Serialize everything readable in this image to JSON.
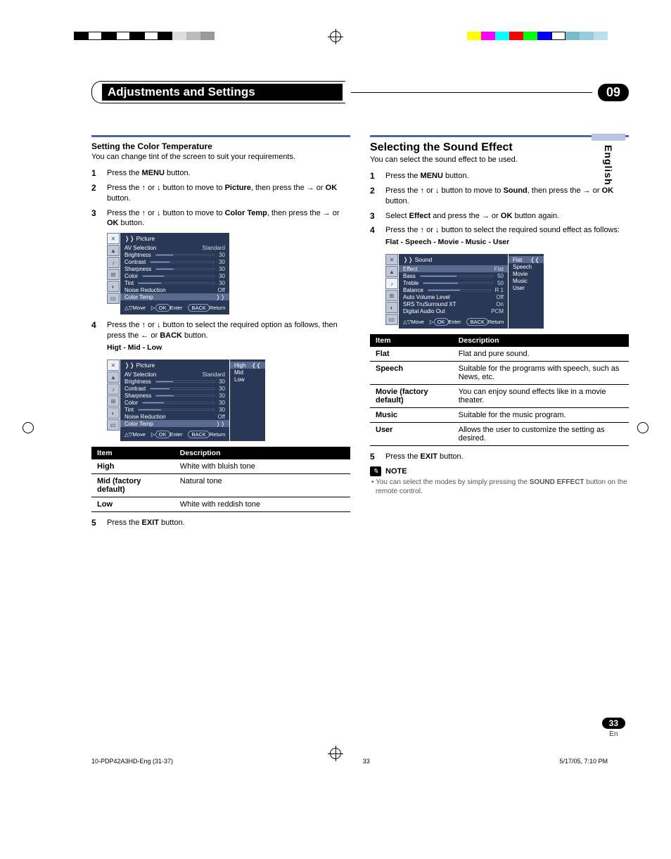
{
  "header": {
    "title": "Adjustments and Settings",
    "chapter": "09"
  },
  "side_tab": "English",
  "color_bar_left": [
    "#000",
    "#000",
    "#000",
    "#000",
    "#000",
    "#fff",
    "#000",
    "#fff",
    "#000",
    "#fff"
  ],
  "color_bar_right": [
    "#ff0",
    "#f0f",
    "#0ff",
    "#0f0",
    "#f00",
    "#00f",
    "#fff",
    "#000",
    "#888",
    "#ccc"
  ],
  "left": {
    "h3": "Setting the Color Temperature",
    "intro": "You can change tint of the screen to suit your requirements.",
    "steps": [
      {
        "n": "1",
        "html": "Press the <b>MENU</b> button."
      },
      {
        "n": "2",
        "html": "Press the <span class='arrow'>↑</span> or <span class='arrow'>↓</span> button to move to <b>Picture</b>, then press the <span class='arrow'>→</span> or <b>OK</b> button."
      },
      {
        "n": "3",
        "html": "Press the <span class='arrow'>↑</span> or <span class='arrow'>↓</span> button to move to <b>Color Temp</b>, then press the <span class='arrow'>→</span> or <b>OK</b> button."
      }
    ],
    "step4": {
      "n": "4",
      "html": "Press the <span class='arrow'>↑</span> or <span class='arrow'>↓</span> button to select the required option as follows, then press the <span class='arrow'>←</span> or <b>BACK</b> button."
    },
    "options_label": "Higt - Mid - Low",
    "table": {
      "headers": [
        "Item",
        "Description"
      ],
      "rows": [
        [
          "High",
          "White with bluish tone"
        ],
        [
          "Mid (factory default)",
          "Natural tone"
        ],
        [
          "Low",
          "White with reddish tone"
        ]
      ]
    },
    "step5": {
      "n": "5",
      "html": "Press the <b>EXIT</b> button."
    },
    "osd1": {
      "title": "Picture",
      "rows": [
        {
          "label": "AV Selection",
          "val": "Standard",
          "bar": null,
          "hl": false
        },
        {
          "label": "Brightness",
          "val": "30",
          "bar": 30,
          "hl": false
        },
        {
          "label": "Contrast",
          "val": "30",
          "bar": 30,
          "hl": false
        },
        {
          "label": "Sharpness",
          "val": "30",
          "bar": 30,
          "hl": false
        },
        {
          "label": "Color",
          "val": "30",
          "bar": 30,
          "hl": false
        },
        {
          "label": "Tint",
          "val": "30",
          "bar": 30,
          "hl": false
        },
        {
          "label": "Noise Reduction",
          "val": "Off",
          "bar": null,
          "hl": false
        },
        {
          "label": "Color Temp",
          "val": "❭❭",
          "bar": null,
          "hl": true
        }
      ],
      "foot": [
        "Move",
        "Enter",
        "Return"
      ],
      "foot_btns": [
        "",
        "OK",
        "BACK"
      ]
    },
    "osd2_extra": [
      "High",
      "Mid",
      "Low"
    ]
  },
  "right": {
    "h2": "Selecting the Sound Effect",
    "intro": "You can select the sound effect to be used.",
    "steps": [
      {
        "n": "1",
        "html": "Press the <b>MENU</b> button."
      },
      {
        "n": "2",
        "html": "Press the <span class='arrow'>↑</span> or <span class='arrow'>↓</span> button to move to <b>Sound</b>, then press the <span class='arrow'>→</span> or <b>OK</b> button."
      },
      {
        "n": "3",
        "html": "Select <b>Effect</b> and press the <span class='arrow'>→</span> or <b>OK</b> button again."
      },
      {
        "n": "4",
        "html": "Press the <span class='arrow'>↑</span> or <span class='arrow'>↓</span> button to select the required sound effect as follows:"
      }
    ],
    "options_label": "Flat - Speech - Movie - Music - User",
    "osd": {
      "title": "Sound",
      "rows": [
        {
          "label": "Effect",
          "val": "Flat",
          "bar": null,
          "hl": true
        },
        {
          "label": "Bass",
          "val": "50",
          "bar": 50,
          "hl": false
        },
        {
          "label": "Treble",
          "val": "50",
          "bar": 50,
          "hl": false
        },
        {
          "label": "Balance",
          "val": "R 1",
          "bar": 51,
          "hl": false
        },
        {
          "label": "Auto Volume Level",
          "val": "Off",
          "bar": null,
          "hl": false
        },
        {
          "label": "SRS TruSurround XT",
          "val": "On",
          "bar": null,
          "hl": false
        },
        {
          "label": "Digital Audio Out",
          "val": "PCM",
          "bar": null,
          "hl": false
        }
      ],
      "foot": [
        "Move",
        "Enter",
        "Return"
      ],
      "foot_btns": [
        "",
        "OK",
        "BACK"
      ]
    },
    "osd_extra": [
      "Flat",
      "Speech",
      "Movie",
      "Music",
      "User"
    ],
    "table": {
      "headers": [
        "Item",
        "Description"
      ],
      "rows": [
        [
          "Flat",
          "Flat and pure sound."
        ],
        [
          "Speech",
          "Suitable for the programs with speech, such as News, etc."
        ],
        [
          "Movie (factory default)",
          "You can enjoy sound effects like in a movie theater."
        ],
        [
          "Music",
          "Suitable for the music program."
        ],
        [
          "User",
          "Allows the user to customize the setting as desired."
        ]
      ]
    },
    "step5": {
      "n": "5",
      "html": "Press the <b>EXIT</b> button."
    },
    "note": {
      "label": "NOTE",
      "text": "You can select the modes by simply pressing the <b>SOUND EFFECT</b> button on the remote control."
    }
  },
  "footer": {
    "left": "10-PDP42A3HD-Eng (31-37)",
    "mid": "33",
    "right": "5/17/05, 7:10 PM"
  },
  "page_num": "33",
  "page_lang": "En"
}
